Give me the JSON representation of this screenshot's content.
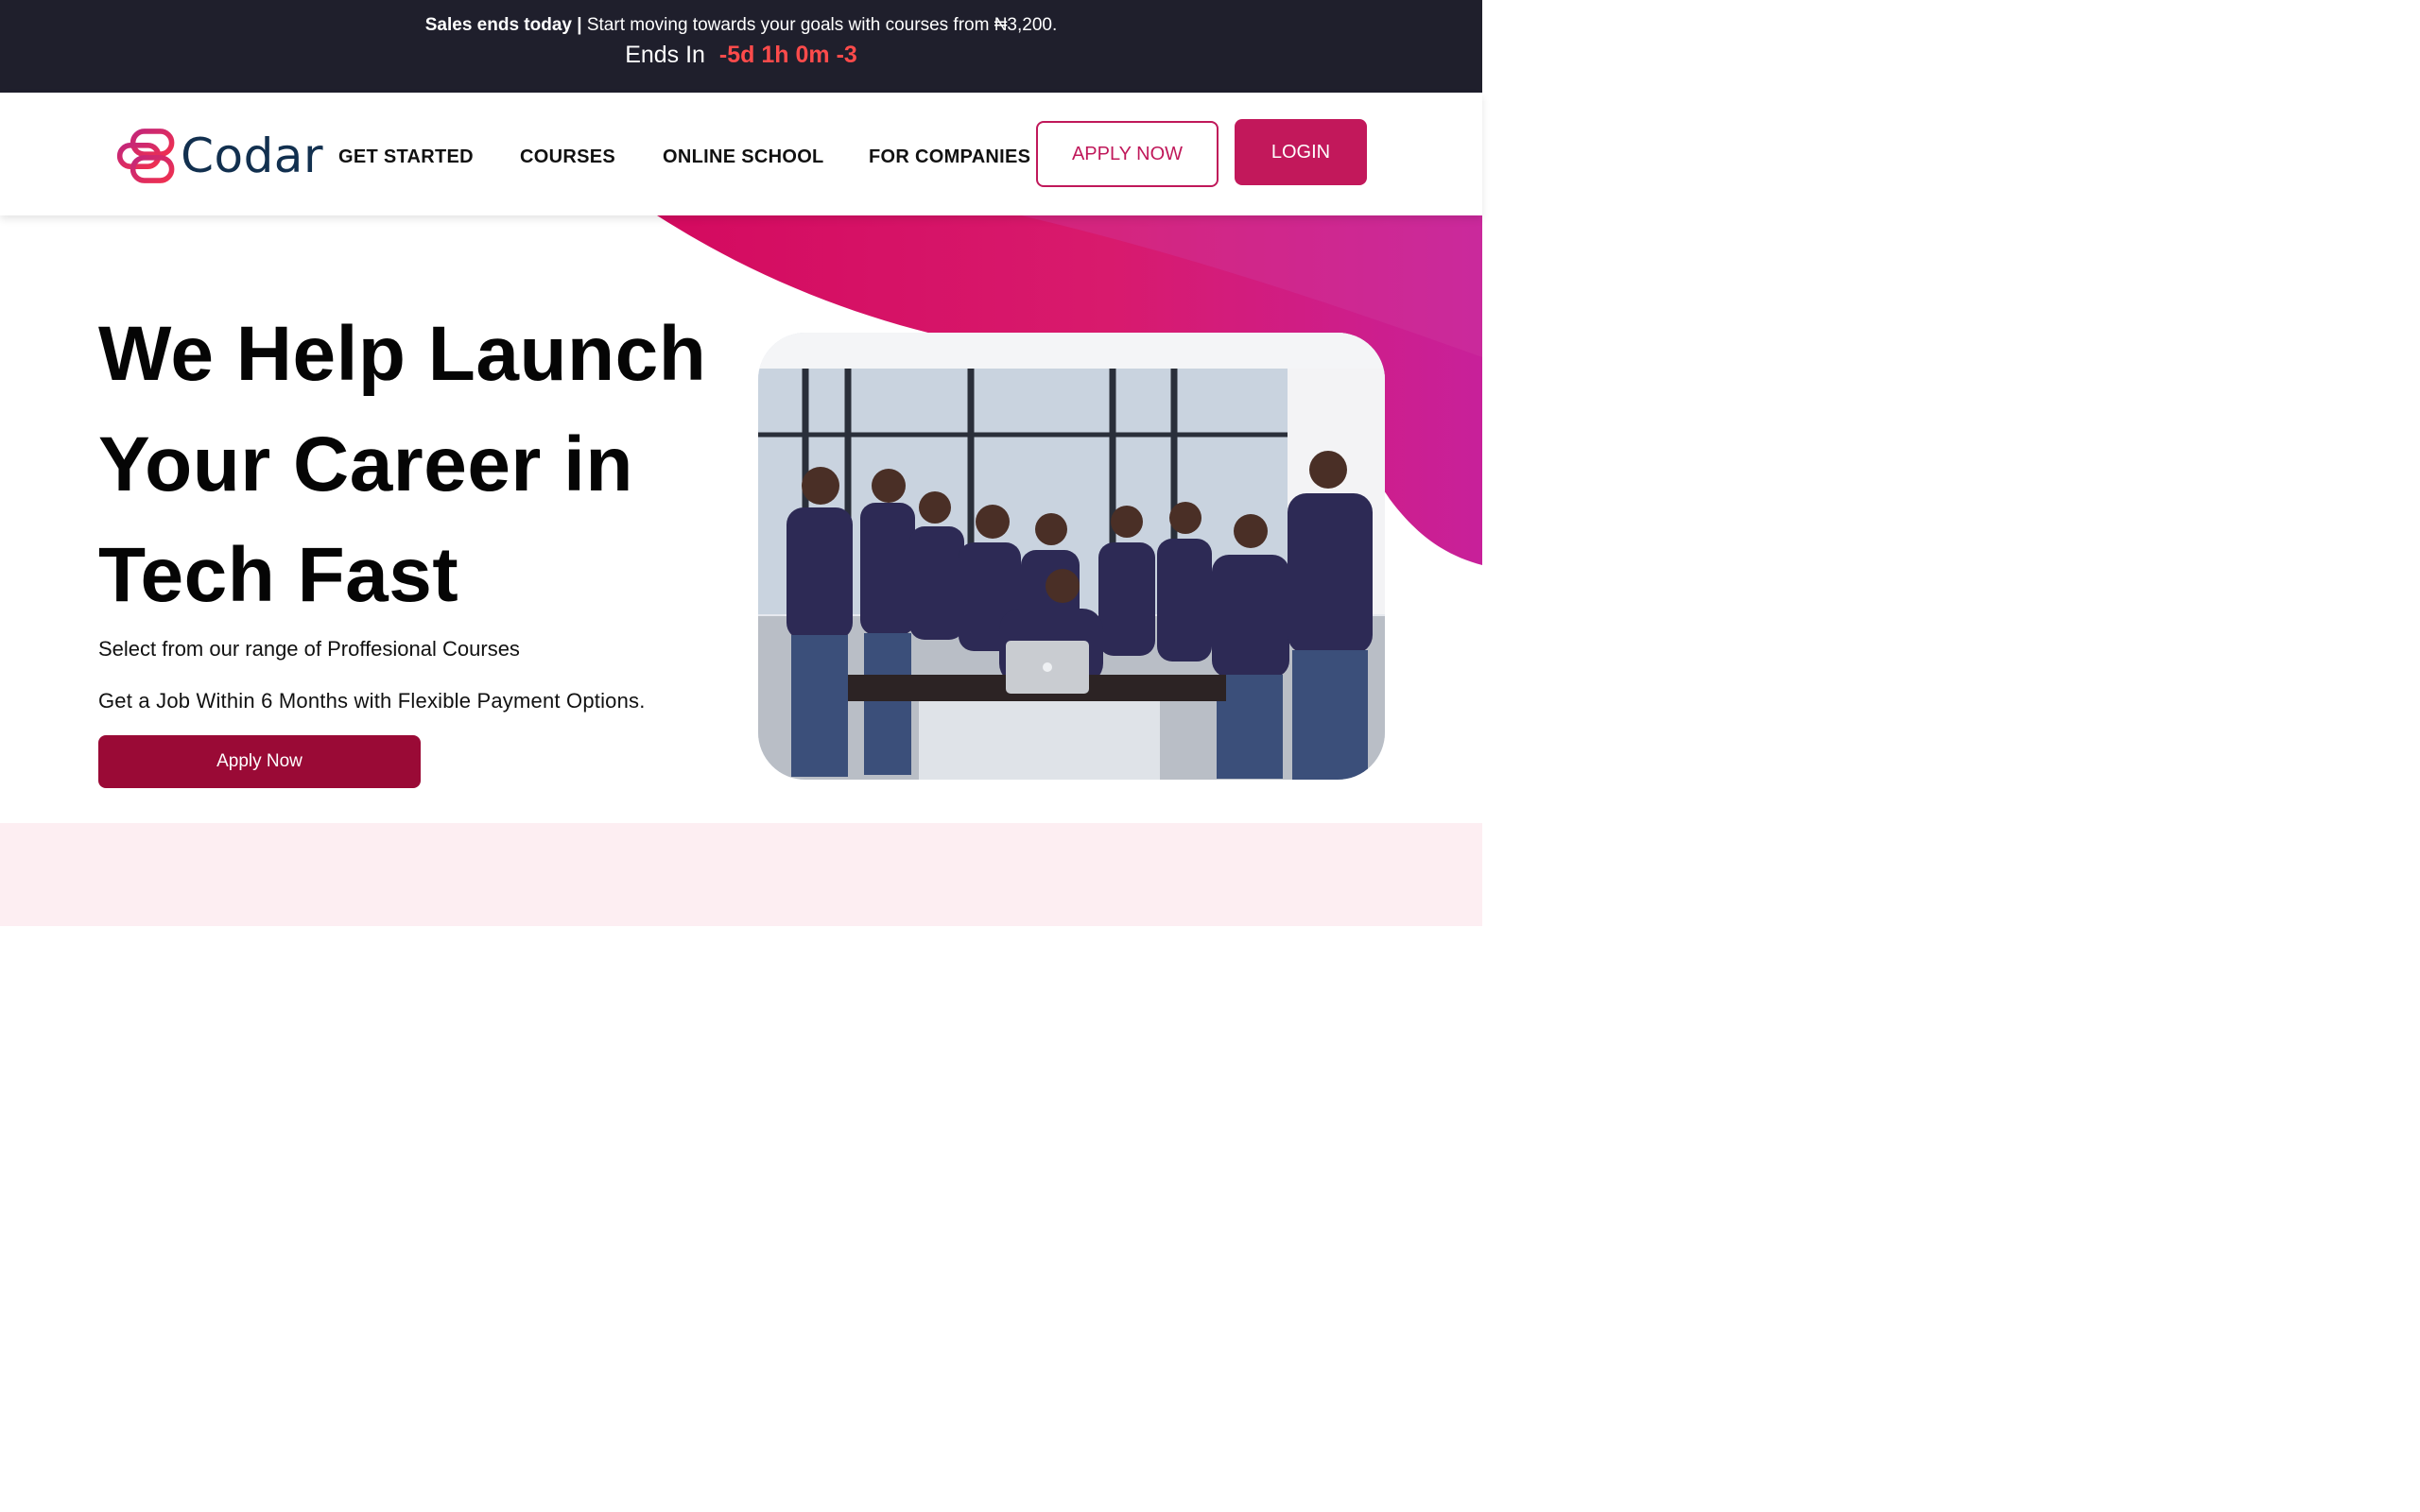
{
  "promo": {
    "headline_bold": "Sales ends today |",
    "headline_rest": " Start moving towards your goals with courses from ₦3,200.",
    "ends_in_label": "Ends In",
    "countdown": "-5d 1h 0m -3"
  },
  "header": {
    "logo_text": "Codar",
    "nav": [
      "GET STARTED",
      "COURSES",
      "ONLINE SCHOOL",
      "FOR COMPANIES"
    ],
    "apply_label": "APPLY NOW",
    "login_label": "LOGIN"
  },
  "hero": {
    "title_lines": [
      "We Help Launch",
      "Your Career in",
      "Tech Fast"
    ],
    "subtitle1": "Select from our range of Proffesional Courses",
    "subtitle2": "Get a Job Within 6 Months with Flexible Payment Options.",
    "cta_label": "Apply Now"
  },
  "colors": {
    "banner_bg": "#1f1f2c",
    "countdown": "#ff4b4b",
    "brand_pink": "#c2185b",
    "cta_dark": "#9a0a36",
    "hero_wave": "#d60a62",
    "lower_bg": "#fdeef2"
  }
}
